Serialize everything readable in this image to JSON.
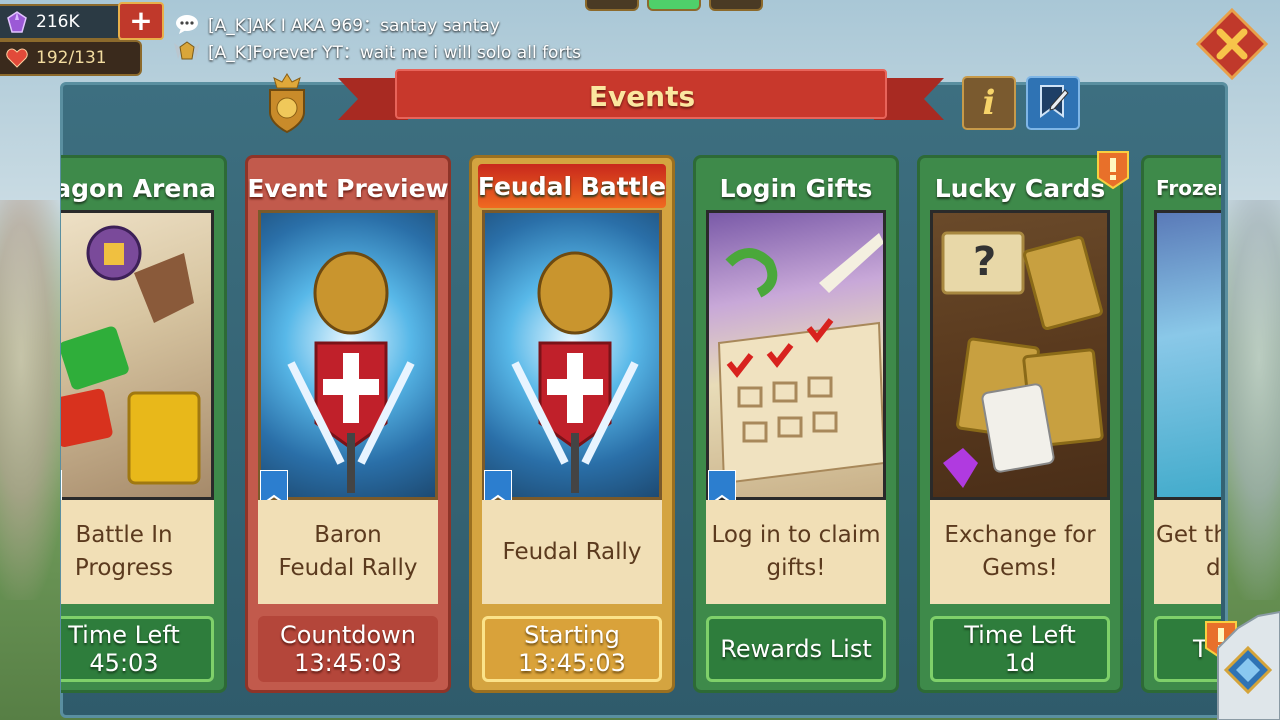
{
  "hud": {
    "gems": "216K",
    "plus_label": "+",
    "hp": "192/131"
  },
  "chat": [
    {
      "text": "[A_K]AK I AKA 969：santay santay"
    },
    {
      "text": "[A_K]Forever YT：wait me i will solo all forts"
    }
  ],
  "panel": {
    "title": "Events",
    "info_label": "i"
  },
  "cards": [
    {
      "title": "ragon Arena",
      "desc_l1": "Battle In",
      "desc_l2": "Progress",
      "timer_l1": "Time Left",
      "timer_l2": "45:03",
      "style": "green"
    },
    {
      "title": "Event Preview",
      "desc_l1": "Baron",
      "desc_l2": "Feudal Rally",
      "timer_l1": "Countdown",
      "timer_l2": "13:45:03",
      "style": "red"
    },
    {
      "title": "Feudal Battle",
      "desc_l1": "Feudal Rally",
      "desc_l2": "",
      "timer_l1": "Starting",
      "timer_l2": "13:45:03",
      "style": "gold"
    },
    {
      "title": "Login Gifts",
      "desc_l1": "Log in to claim",
      "desc_l2": "gifts!",
      "timer_l1": "Rewards List",
      "timer_l2": "",
      "style": "green"
    },
    {
      "title": "Lucky Cards",
      "desc_l1": "Exchange for",
      "desc_l2": "Gems!",
      "timer_l1": "Time Left",
      "timer_l2": "1d",
      "style": "green"
    },
    {
      "title": "Frozen",
      "desc_l1": "Get th",
      "desc_l2": "d",
      "timer_l1": "T",
      "timer_l2": "",
      "style": "green"
    }
  ],
  "colors": {
    "panel": "#3d6f80",
    "card_green": "#3e8a4a",
    "card_red": "#c25a4c",
    "card_gold": "#d4a440",
    "banner_red": "#c0392b"
  },
  "icons": [
    "gem-icon",
    "heart-icon",
    "chat-bubble-icon",
    "rank-badge-icon",
    "close-icon",
    "crest-icon",
    "info-icon",
    "notes-icon",
    "bookmark-icon",
    "alert-icon"
  ]
}
